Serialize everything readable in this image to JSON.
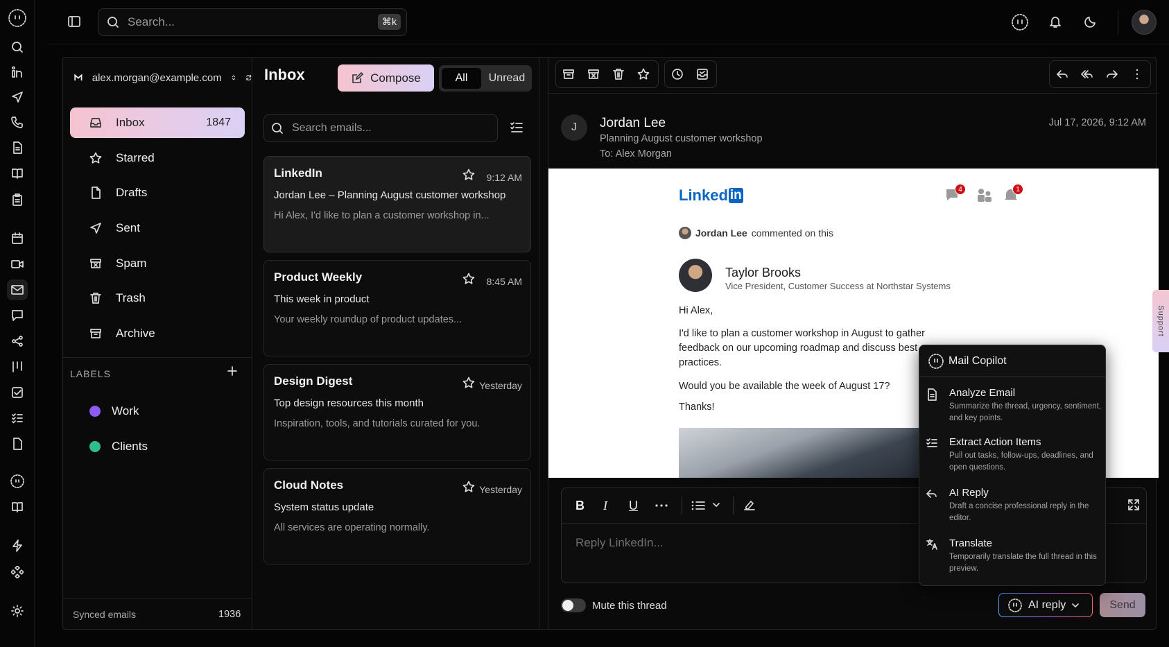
{
  "topbar": {
    "search_placeholder": "Search...",
    "shortcut": "⌘k"
  },
  "account": {
    "email": "alex.morgan@example.com"
  },
  "folders": [
    {
      "label": "Inbox",
      "count": "1847",
      "icon": "inbox-icon"
    },
    {
      "label": "Starred",
      "icon": "star-icon"
    },
    {
      "label": "Drafts",
      "icon": "file-icon"
    },
    {
      "label": "Sent",
      "icon": "send-icon"
    },
    {
      "label": "Spam",
      "icon": "spam-icon"
    },
    {
      "label": "Trash",
      "icon": "trash-icon"
    },
    {
      "label": "Archive",
      "icon": "archive-icon"
    }
  ],
  "labels": {
    "heading": "LABELS",
    "items": [
      {
        "label": "Work",
        "color": "#8b5cf6"
      },
      {
        "label": "Clients",
        "color": "#2ebd8f"
      }
    ]
  },
  "sync": {
    "label": "Synced emails",
    "count": "1936"
  },
  "list": {
    "title": "Inbox",
    "compose": "Compose",
    "filter_all": "All",
    "filter_unread": "Unread",
    "search_placeholder": "Search emails...",
    "emails": [
      {
        "from": "LinkedIn",
        "time": "9:12 AM",
        "subject": "Jordan Lee – Planning August customer workshop",
        "preview": "Hi Alex, I'd like to plan a customer workshop in..."
      },
      {
        "from": "Product Weekly",
        "time": "8:45 AM",
        "subject": "This week in product",
        "preview": "Your weekly roundup of product updates..."
      },
      {
        "from": "Design Digest",
        "time": "Yesterday",
        "subject": "Top design resources this month",
        "preview": "Inspiration, tools, and tutorials curated for you."
      },
      {
        "from": "Cloud Notes",
        "time": "Yesterday",
        "subject": "System status update",
        "preview": "All services are operating normally."
      }
    ]
  },
  "reader": {
    "avatar_letter": "J",
    "sender": "Jordan Lee",
    "subject": "Planning August customer workshop",
    "to": "To: Alex Morgan",
    "date": "Jul 17, 2026, 9:12 AM",
    "body": {
      "logo_text": "Linked",
      "logo_in": "in",
      "msg_badge": "4",
      "notif_badge": "1",
      "commenter": "Jordan Lee",
      "commented": "commented on this",
      "profile_name": "Taylor Brooks",
      "profile_title": "Vice President, Customer Success at Northstar Systems",
      "greeting": "Hi Alex,",
      "para1": "I'd like to plan a customer workshop in August to gather feedback on our upcoming roadmap and discuss best practices.",
      "para2": "Would you be available the week of August 17?",
      "thanks": "Thanks!"
    },
    "reply_placeholder": "Reply LinkedIn...",
    "mute_label": "Mute this thread",
    "ai_reply": "AI reply",
    "send": "Send"
  },
  "copilot": {
    "title": "Mail Copilot",
    "items": [
      {
        "title": "Analyze Email",
        "desc": "Summarize the thread, urgency, sentiment, and key points."
      },
      {
        "title": "Extract Action Items",
        "desc": "Pull out tasks, follow-ups, deadlines, and open questions."
      },
      {
        "title": "AI Reply",
        "desc": "Draft a concise professional reply in the editor."
      },
      {
        "title": "Translate",
        "desc": "Temporarily translate the full thread in this preview."
      }
    ]
  },
  "support_tab": "Support"
}
